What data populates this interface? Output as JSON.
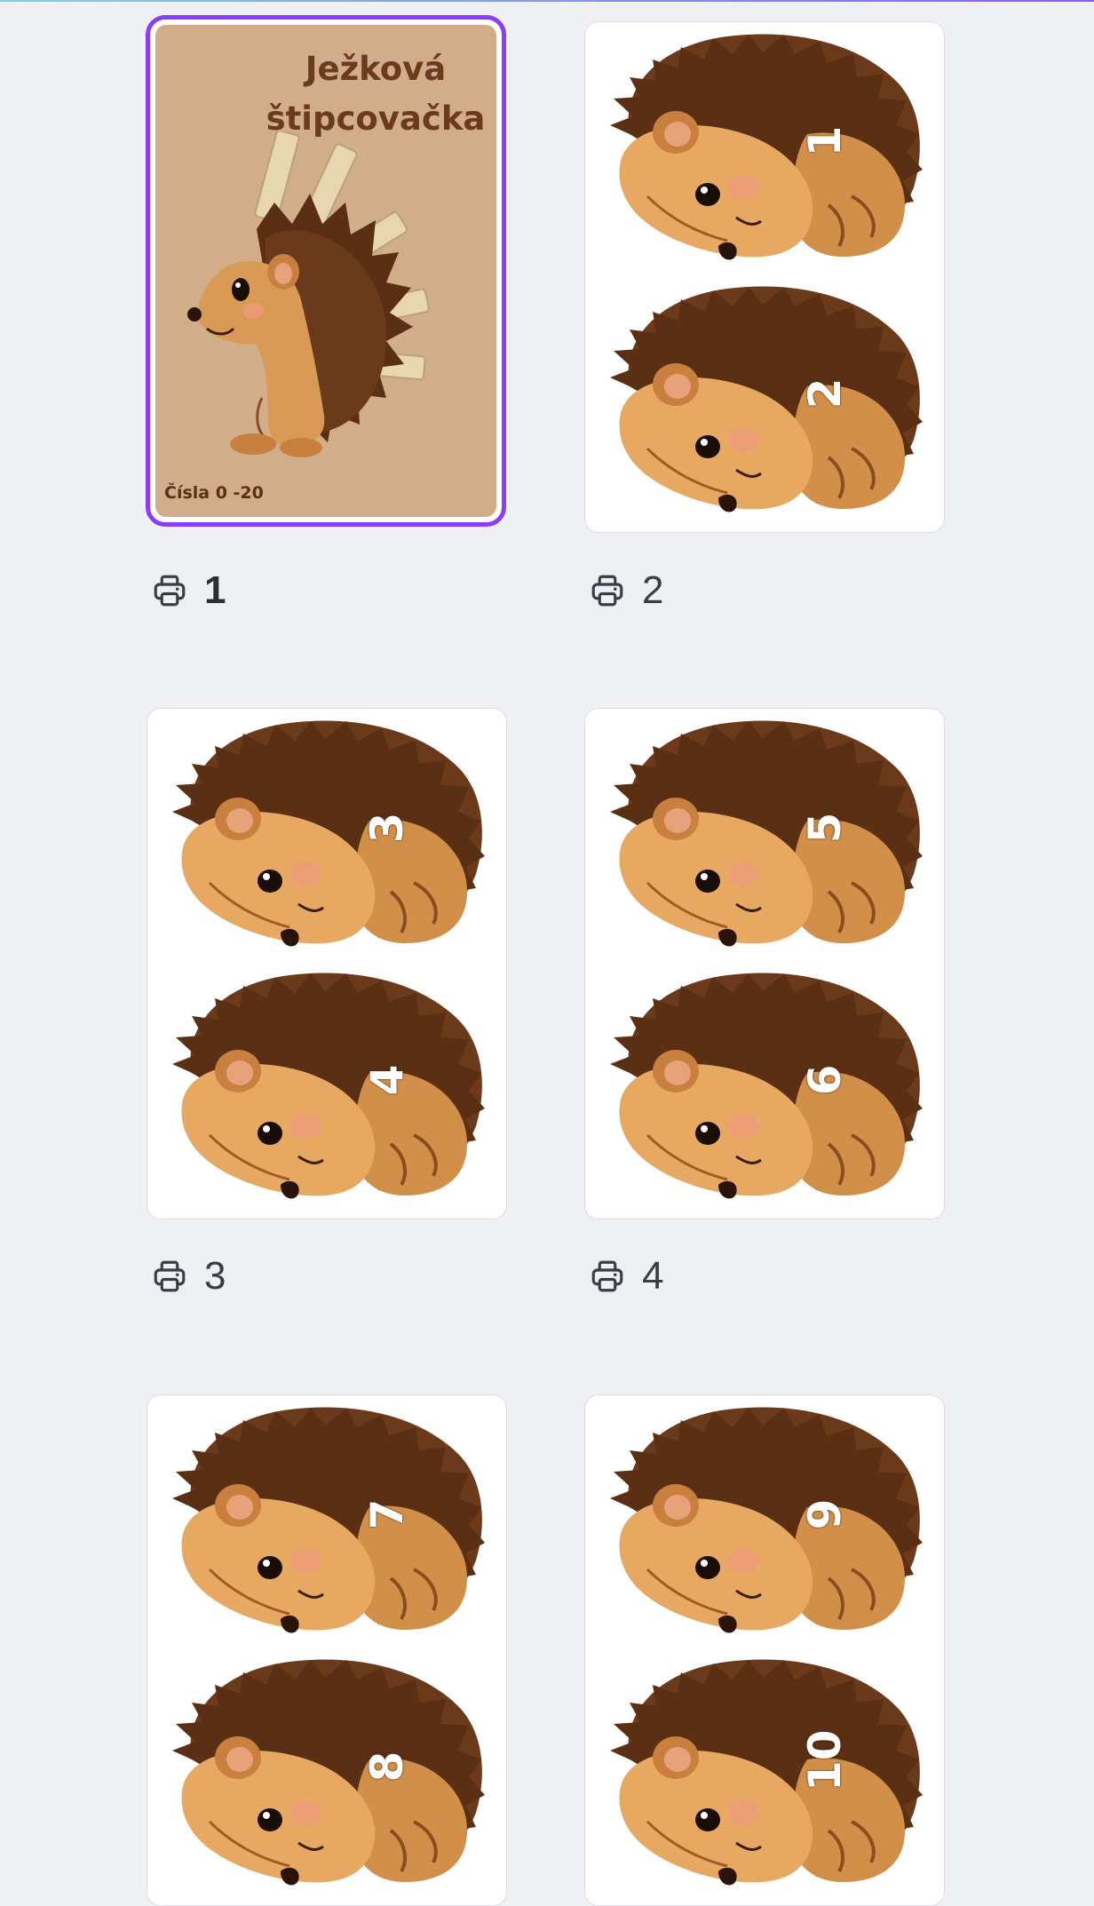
{
  "cover": {
    "title": "Ježková\nštipcovačka",
    "subtitle": "Čísla 0 -20"
  },
  "pages": [
    {
      "label": "1",
      "selected": true
    },
    {
      "label": "2",
      "numbers": [
        "1",
        "2"
      ]
    },
    {
      "label": "3",
      "numbers": [
        "3",
        "4"
      ]
    },
    {
      "label": "4",
      "numbers": [
        "5",
        "6"
      ]
    },
    {
      "numbers": [
        "7",
        "8"
      ]
    },
    {
      "numbers": [
        "9",
        "10"
      ]
    }
  ],
  "icons": {
    "page_label": "printer-icon"
  },
  "colors": {
    "selection": "#8b3dff",
    "background": "#eff0f4"
  }
}
